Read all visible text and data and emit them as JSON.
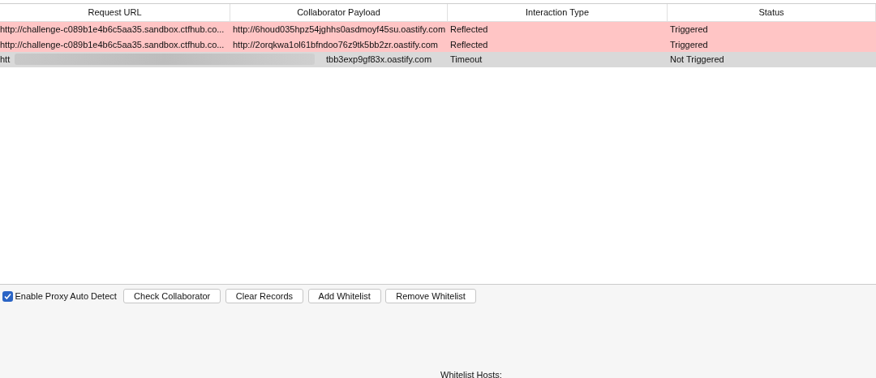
{
  "table": {
    "columns": [
      "Request URL",
      "Collaborator Payload",
      "Interaction Type",
      "Status"
    ],
    "rows": [
      {
        "color": "#ffc5c5",
        "cells": [
          "http://challenge-c089b1e4b6c5aa35.sandbox.ctfhub.co...",
          "http://6houd035hpz54jghhs0asdmoyf45su.oastify.com",
          "Reflected",
          "Triggered"
        ],
        "redacted": false
      },
      {
        "color": "#ffc5c5",
        "cells": [
          "http://challenge-c089b1e4b6c5aa35.sandbox.ctfhub.co...",
          "http://2orqkwa1ol61bfndoo76z9tk5bb2zr.oastify.com",
          "Reflected",
          "Triggered"
        ],
        "redacted": false
      },
      {
        "color": "#d9d9d9",
        "cells": [
          "htt",
          "tbb3exp9gf83x.oastify.com",
          "Timeout",
          "Not Triggered"
        ],
        "redacted": true
      }
    ]
  },
  "controls": {
    "proxy_checkbox": {
      "label": "Enable Proxy Auto Detect",
      "checked": true
    },
    "buttons": [
      "Check Collaborator",
      "Clear Records",
      "Add Whitelist",
      "Remove Whitelist"
    ]
  },
  "whitelist_label": "Whitelist Hosts:"
}
